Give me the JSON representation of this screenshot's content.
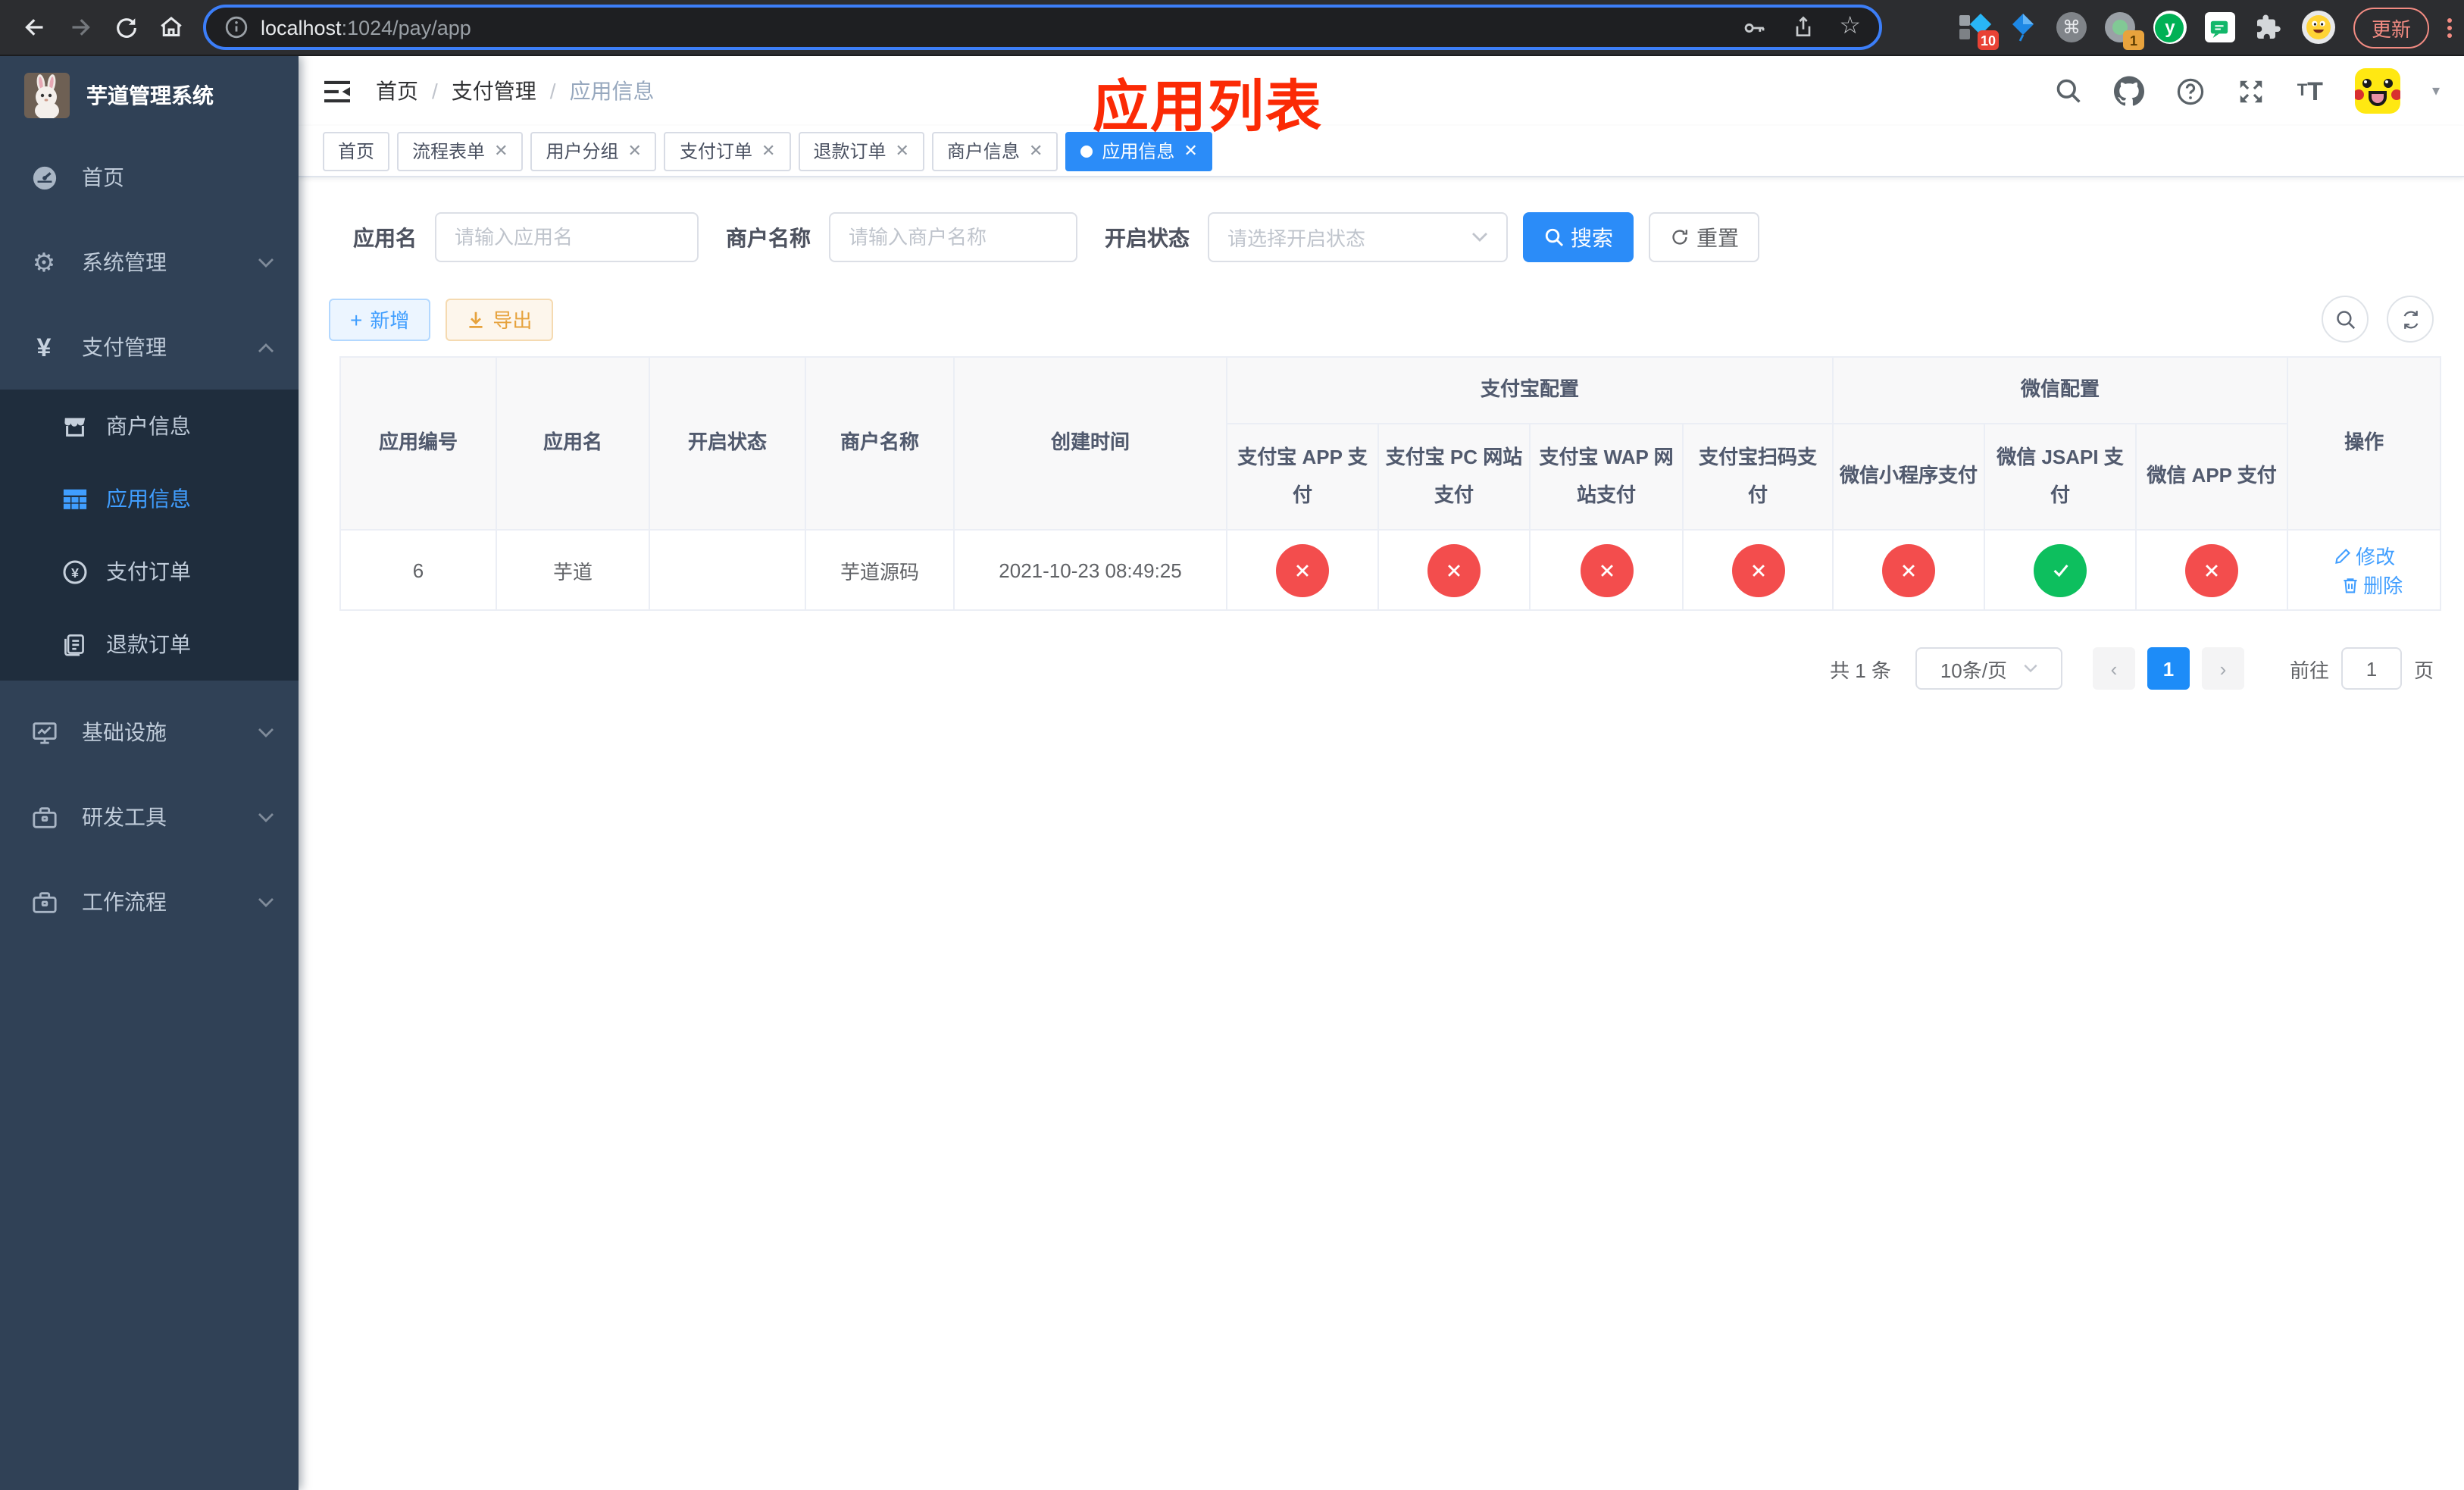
{
  "colors": {
    "primary_link": "#409eff",
    "primary_solid": "#1d8cf8",
    "tab_active": "#2b8cf8",
    "danger_dot": "#f34d4d",
    "success_dot": "#0dbf5e",
    "export_orange": "#e6a23c",
    "annotation_red": "#fb2a05",
    "sidebar_bg": "#304156",
    "submenu_bg": "#1f2d3d",
    "browser_toolbar_bg": "#2c2d30"
  },
  "icons": {
    "back-icon": "left arrow",
    "forward-icon": "right arrow",
    "reload-icon": "circular arrow",
    "home-icon": "house",
    "page-info-icon": "circled i",
    "key-icon": "key",
    "share-icon": "box with up arrow",
    "bookmark-star-icon": "star outline",
    "tab-groups-extension-icon": "squares with blue diamond",
    "kite-extension-icon": "blue kite",
    "command-extension-icon": "command glyph in gray circle",
    "recorder-extension-icon": "gray circle with green dot",
    "y-extension-icon": "white y on green circle",
    "chat-extension-icon": "green chat bubble",
    "extensions-puzzle-icon": "puzzle piece",
    "profile-avatar-icon": "yellow emoji face",
    "kebab-menu-icon": "three vertical dots",
    "collapse-sidebar-icon": "indent lines with left triangle",
    "search-icon": "magnifier",
    "github-icon": "octocat",
    "help-icon": "circled question mark",
    "fullscreen-icon": "four outward arrows",
    "font-size-icon": "small and large T",
    "caret-down-icon": "small down triangle",
    "dashboard-icon": "speedometer",
    "gear-icon": "cogwheel",
    "yen-icon": "yen sign",
    "shop-icon": "storefront",
    "grid-icon": "table grid",
    "yen-circle-icon": "circled yen",
    "document-icon": "sheet with lines",
    "monitor-icon": "screen with chart",
    "briefcase-icon": "suitcase",
    "chevron-down-icon": "down chevron",
    "chevron-up-icon": "up chevron",
    "close-icon": "x",
    "plus-icon": "plus",
    "download-icon": "down arrow with bar",
    "refresh-icon": "two circular arrows",
    "edit-icon": "pencil",
    "delete-icon": "trash can",
    "cross-status-icon": "white x in red circle",
    "check-status-icon": "white check in green circle"
  },
  "browser": {
    "url": {
      "host": "localhost",
      "rest": ":1024/pay/app"
    },
    "update_button": "更新",
    "badges": {
      "tab_groups": "10",
      "recorder": "1"
    },
    "y_extension_letter": "y"
  },
  "sidebar": {
    "title": "芋道管理系统",
    "menu": [
      {
        "label": "首页"
      },
      {
        "label": "系统管理"
      },
      {
        "label": "支付管理"
      },
      {
        "label": "商户信息"
      },
      {
        "label": "应用信息"
      },
      {
        "label": "支付订单"
      },
      {
        "label": "退款订单"
      },
      {
        "label": "基础设施"
      },
      {
        "label": "研发工具"
      },
      {
        "label": "工作流程"
      }
    ]
  },
  "header": {
    "breadcrumb": [
      "首页",
      "支付管理",
      "应用信息"
    ],
    "annotation_title": "应用列表"
  },
  "tabs": [
    {
      "label": "首页"
    },
    {
      "label": "流程表单"
    },
    {
      "label": "用户分组"
    },
    {
      "label": "支付订单"
    },
    {
      "label": "退款订单"
    },
    {
      "label": "商户信息"
    },
    {
      "label": "应用信息"
    }
  ],
  "filters": {
    "app_name_label": "应用名",
    "app_name_placeholder": "请输入应用名",
    "merchant_label": "商户名称",
    "merchant_placeholder": "请输入商户名称",
    "status_label": "开启状态",
    "status_placeholder": "请选择开启状态",
    "search_button": "搜索",
    "reset_button": "重置"
  },
  "toolbar": {
    "add_button": "新增",
    "export_button": "导出"
  },
  "table": {
    "headers": {
      "app_id": "应用编号",
      "app_name": "应用名",
      "open_status": "开启状态",
      "merchant_name": "商户名称",
      "create_time": "创建时间",
      "alipay_group": "支付宝配置",
      "wechat_group": "微信配置",
      "action": "操作",
      "channels": [
        "支付宝 APP 支付",
        "支付宝 PC 网站支付",
        "支付宝 WAP 网站支付",
        "支付宝扫码支付",
        "微信小程序支付",
        "微信 JSAPI 支付",
        "微信 APP 支付"
      ]
    },
    "row": {
      "app_id": "6",
      "app_name": "芋道",
      "enabled": true,
      "merchant_name": "芋道源码",
      "create_time": "2021-10-23 08:49:25",
      "channels": [
        {
          "name": "支付宝 APP 支付",
          "enabled": false
        },
        {
          "name": "支付宝 PC 网站支付",
          "enabled": false
        },
        {
          "name": "支付宝 WAP 网站支付",
          "enabled": false
        },
        {
          "name": "支付宝扫码支付",
          "enabled": false
        },
        {
          "name": "微信小程序支付",
          "enabled": false
        },
        {
          "name": "微信 JSAPI 支付",
          "enabled": true
        },
        {
          "name": "微信 APP 支付",
          "enabled": false
        }
      ],
      "actions": {
        "edit": "修改",
        "delete": "删除"
      }
    }
  },
  "pagination": {
    "total": "共 1 条",
    "page_size": "10条/页",
    "current_page": "1",
    "goto_label": "前往",
    "goto_value": "1",
    "page_unit": "页"
  }
}
